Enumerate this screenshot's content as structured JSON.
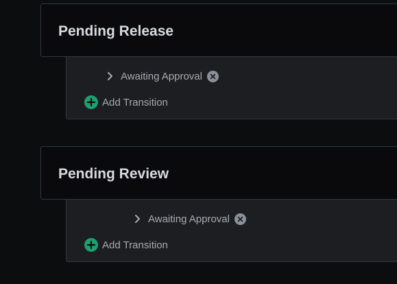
{
  "states": [
    {
      "title": "Pending Release",
      "transitions": [
        {
          "label": "Awaiting Approval"
        }
      ],
      "add_transition_label": "Add Transition"
    },
    {
      "title": "Pending Review",
      "transitions": [
        {
          "label": "Awaiting Approval"
        }
      ],
      "add_transition_label": "Add Transition"
    }
  ],
  "colors": {
    "accent_add": "#1f9e6e",
    "remove_badge": "#8b919a",
    "text_primary": "#d7dadf",
    "text_secondary": "#a7acb3"
  },
  "icons": {
    "expand": "chevron-right-icon",
    "remove": "close-circle-icon",
    "add": "plus-circle-icon"
  }
}
